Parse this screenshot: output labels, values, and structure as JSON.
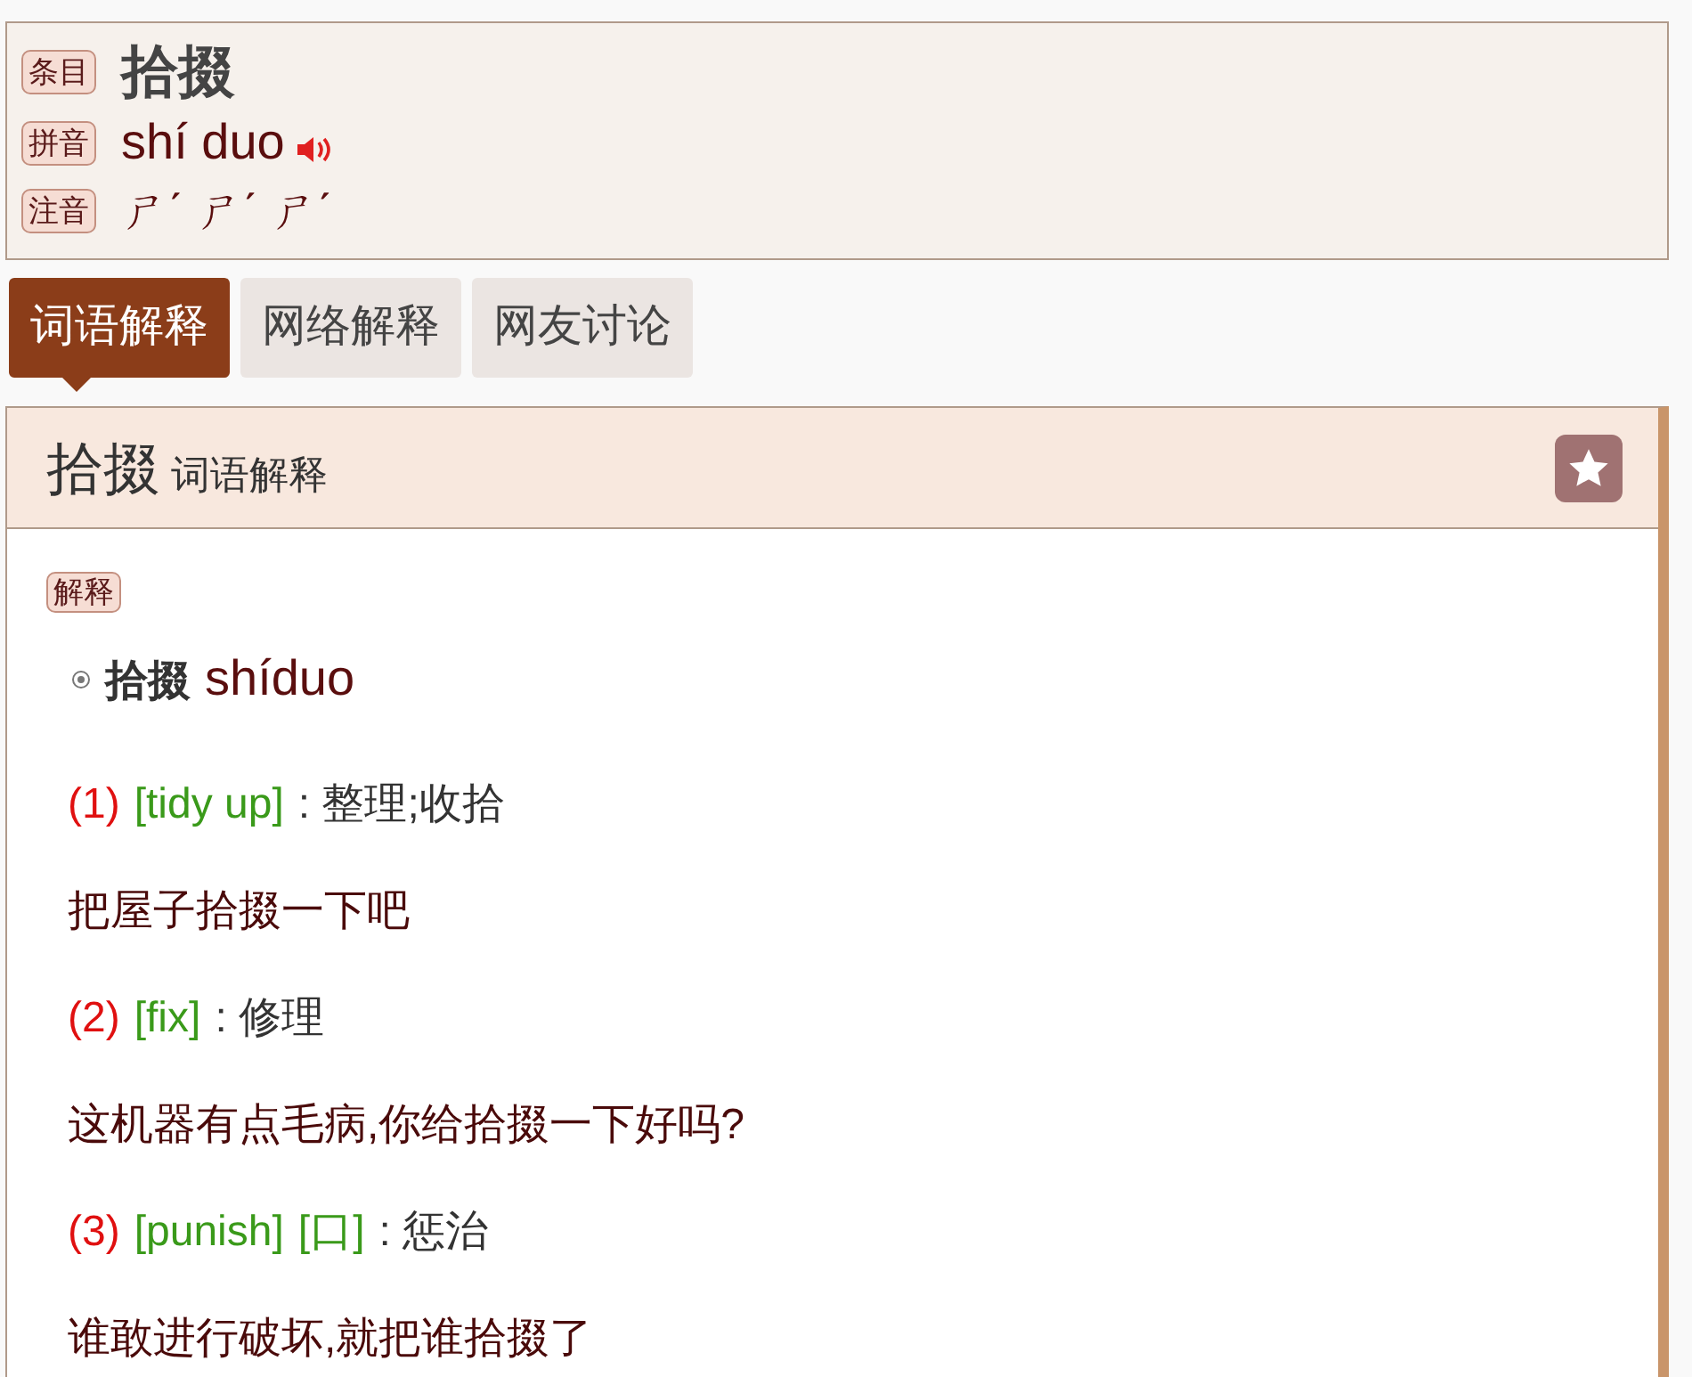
{
  "header": {
    "rows": [
      {
        "kind": "headword",
        "label": "条目",
        "text": "拾掇"
      },
      {
        "kind": "pinyin",
        "label": "拼音",
        "text": "shí duo"
      },
      {
        "kind": "zhuyin",
        "label": "注音",
        "text": "ㄕˊ ㄕˊ ㄕˊ"
      }
    ]
  },
  "tabs": [
    {
      "label": "词语解释",
      "selected": true
    },
    {
      "label": "网络解释",
      "selected": false
    },
    {
      "label": "网友讨论",
      "selected": false
    }
  ],
  "panel": {
    "title": "拾掇",
    "subtitle": "词语解释",
    "section_label": "解释",
    "heading": {
      "word": "拾掇",
      "pinyin": "shíduo"
    },
    "items": [
      {
        "kind": "sense",
        "number": "(1)",
        "tags": [
          "[tidy up]"
        ],
        "meaning": ": 整理;收拾"
      },
      {
        "kind": "example",
        "text": "把屋子拾掇一下吧"
      },
      {
        "kind": "sense",
        "number": "(2)",
        "tags": [
          "[fix]"
        ],
        "meaning": ": 修理"
      },
      {
        "kind": "example",
        "text": "这机器有点毛病,你给拾掇一下好吗?"
      },
      {
        "kind": "sense",
        "number": "(3)",
        "tags": [
          "[punish]",
          "[口]"
        ],
        "meaning": ": 惩治"
      },
      {
        "kind": "example",
        "text": "谁敢进行破坏,就把谁拾掇了"
      }
    ]
  }
}
